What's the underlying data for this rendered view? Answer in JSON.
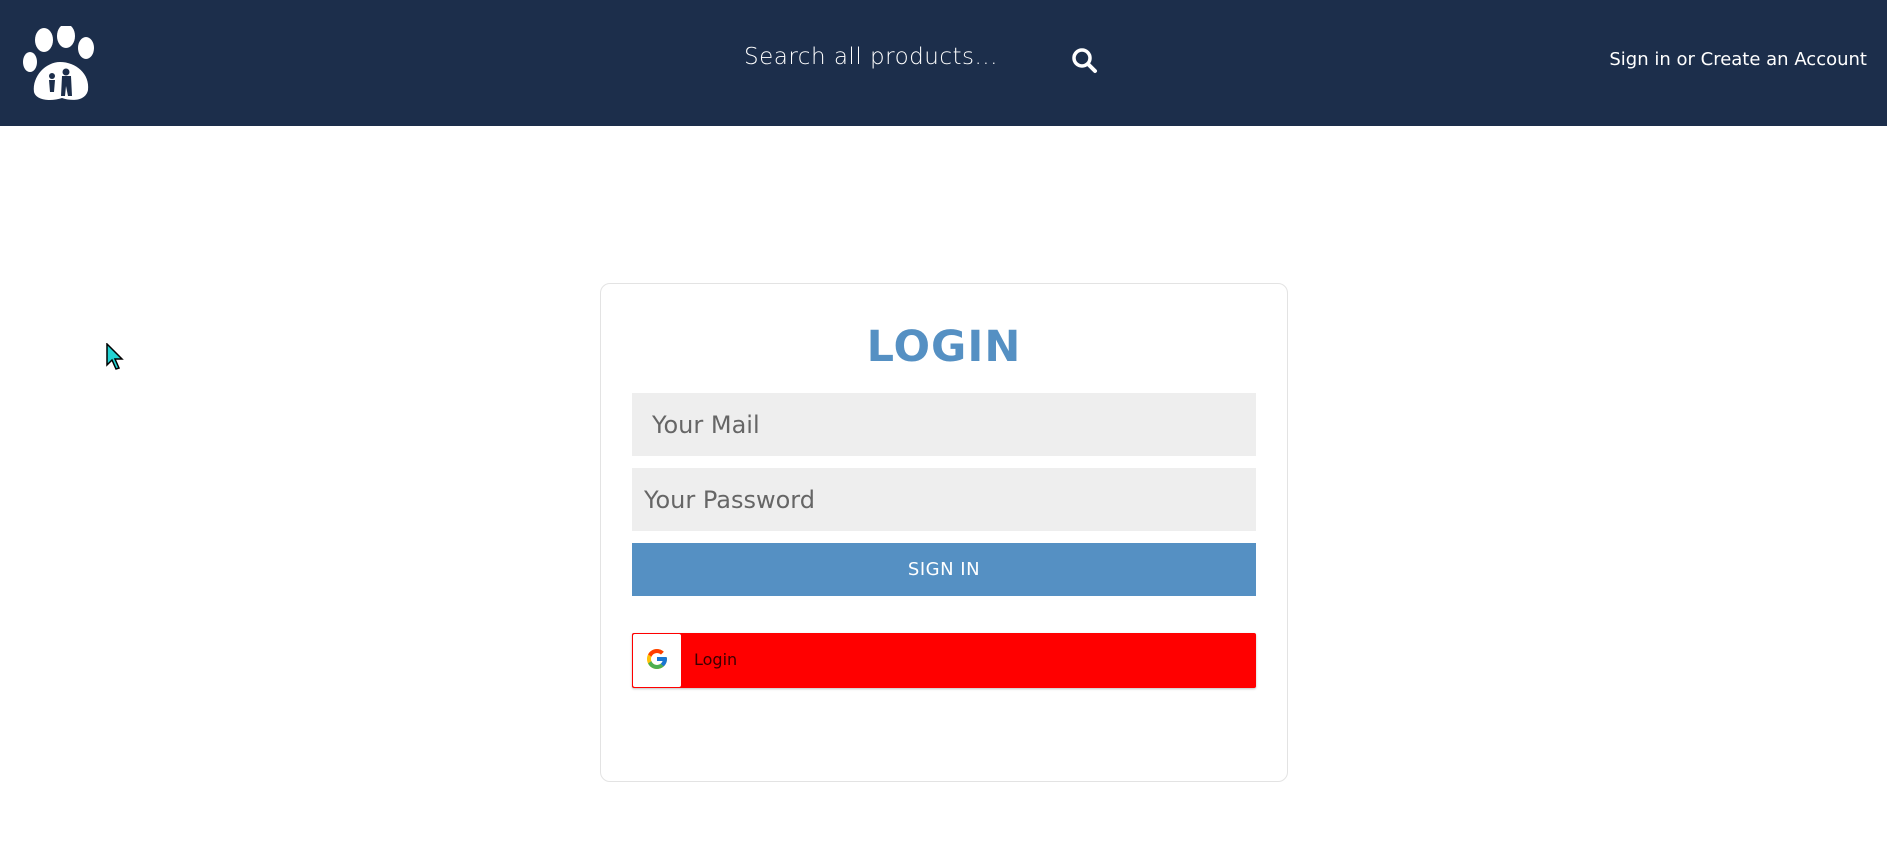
{
  "header": {
    "logo_icon": "paw-logo-icon",
    "search": {
      "placeholder": "Search all products...",
      "icon": "search-icon"
    },
    "account_link": "Sign in or Create an Account",
    "background_color": "#1c2e4b"
  },
  "login": {
    "title": "LOGIN",
    "mail_placeholder": "Your Mail",
    "password_placeholder": "Your Password",
    "signin_label": "SIGN IN",
    "google_label": "Login",
    "google_icon": "google-g-icon",
    "accent_color": "#5590c3",
    "google_button_color": "#ff0000"
  }
}
